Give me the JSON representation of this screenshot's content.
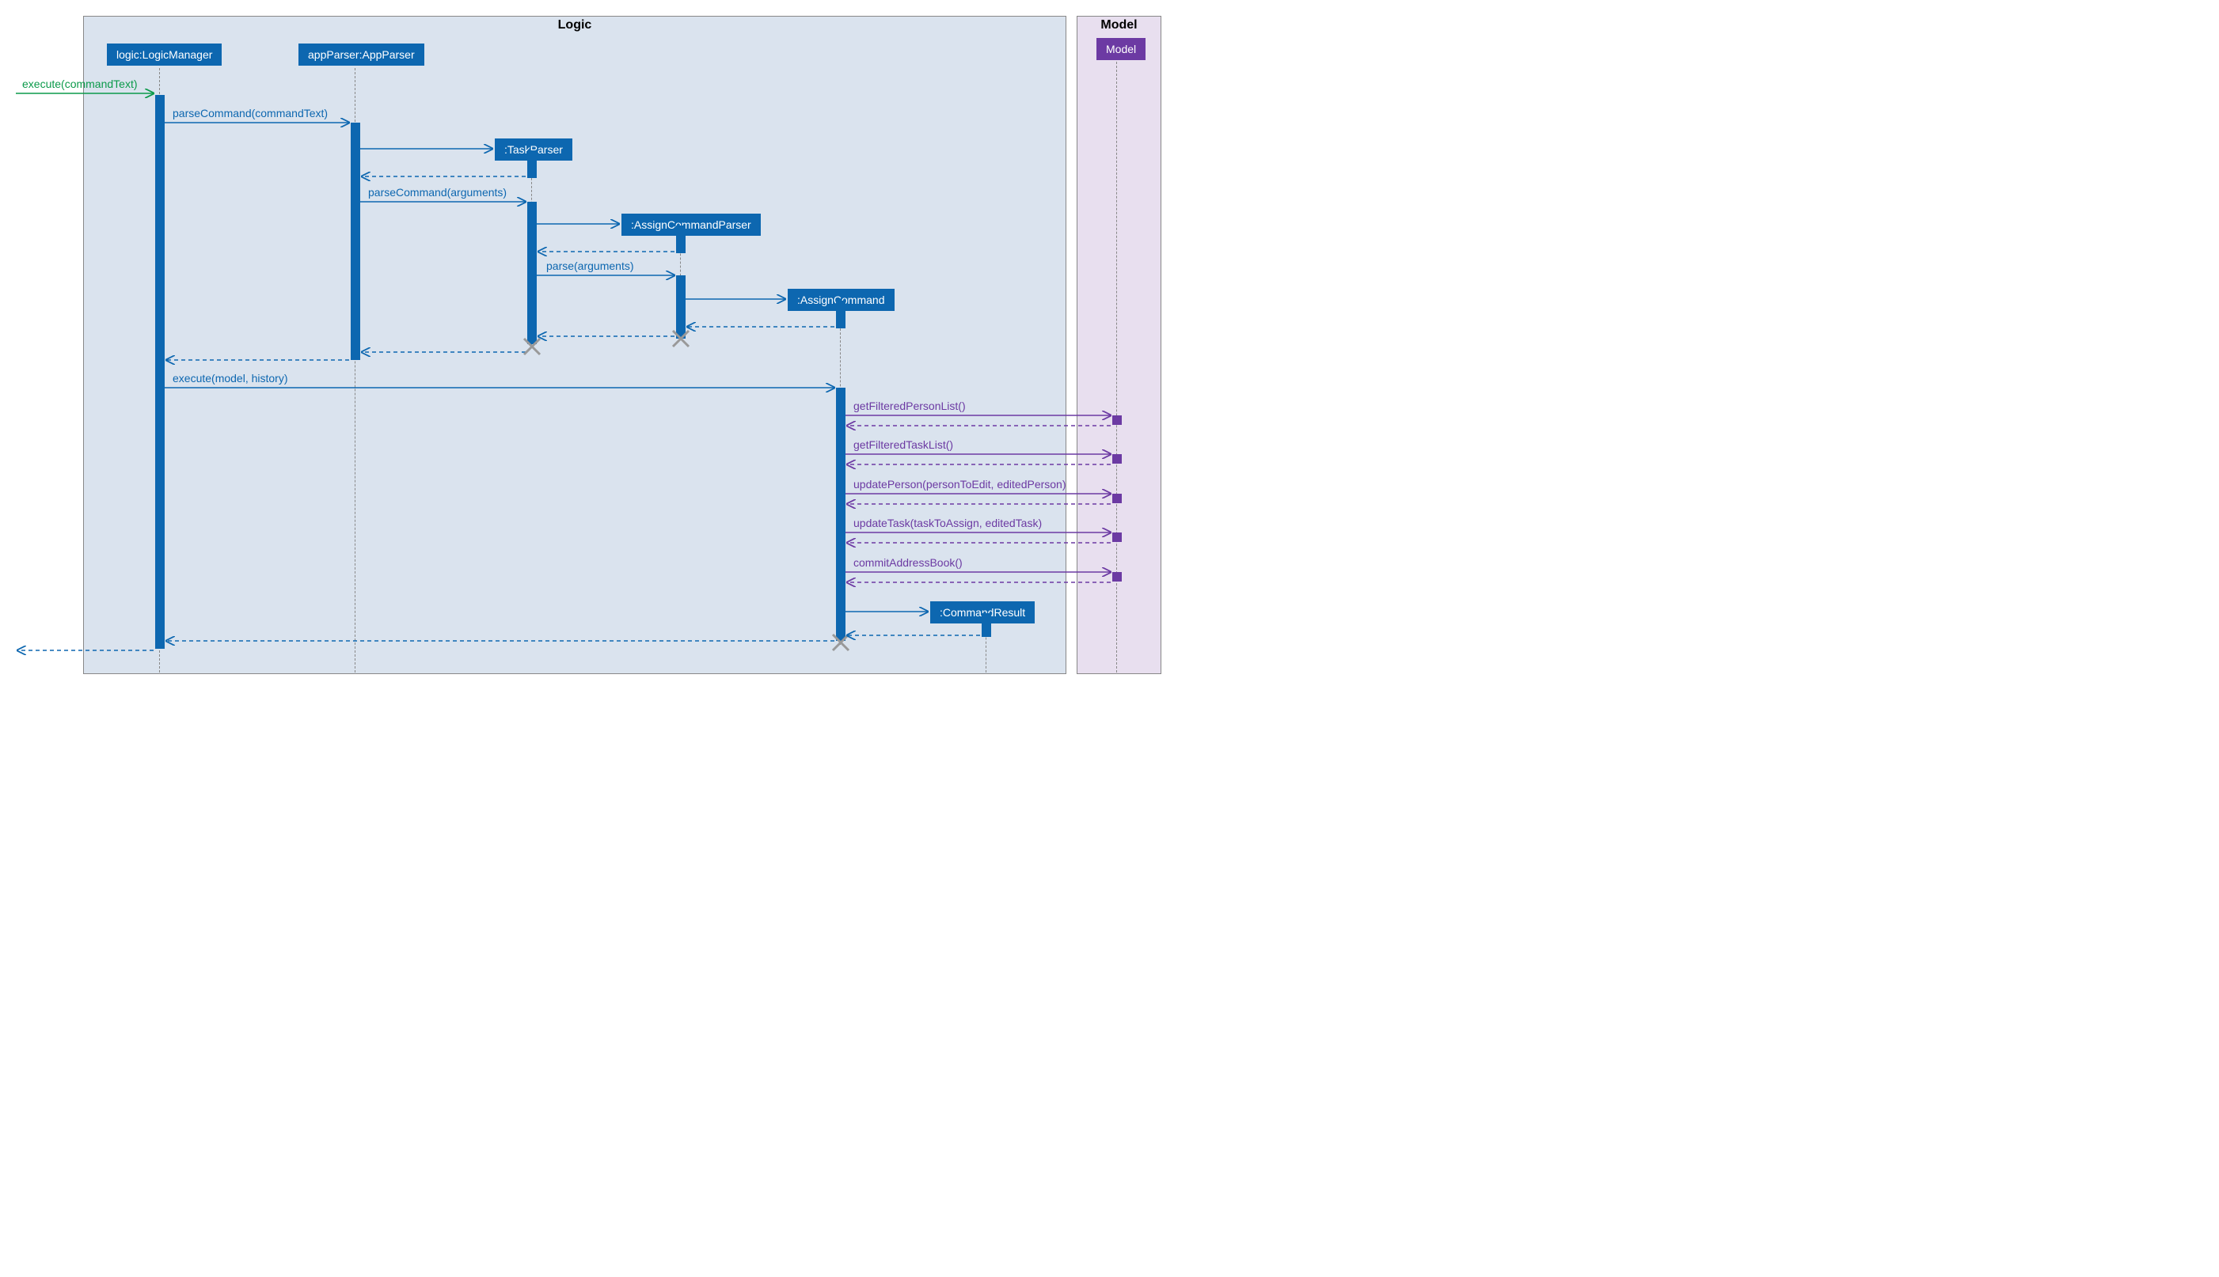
{
  "frames": {
    "logic": "Logic",
    "model": "Model"
  },
  "lifelines": {
    "logicManager": "logic:LogicManager",
    "appParser": "appParser:AppParser",
    "taskParser": ":TaskParser",
    "assignCommandParser": ":AssignCommandParser",
    "assignCommand": ":AssignCommand",
    "commandResult": ":CommandResult",
    "model": "Model"
  },
  "messages": {
    "executeIn": "execute(commandText)",
    "parseCommand1": "parseCommand(commandText)",
    "parseCommand2": "parseCommand(arguments)",
    "parse": "parse(arguments)",
    "executeModel": "execute(model, history)",
    "getFilteredPersonList": "getFilteredPersonList()",
    "getFilteredTaskList": "getFilteredTaskList()",
    "updatePerson": "updatePerson(personToEdit, editedPerson)",
    "updateTask": "updateTask(taskToAssign, editedTask)",
    "commitAddressBook": "commitAddressBook()"
  }
}
